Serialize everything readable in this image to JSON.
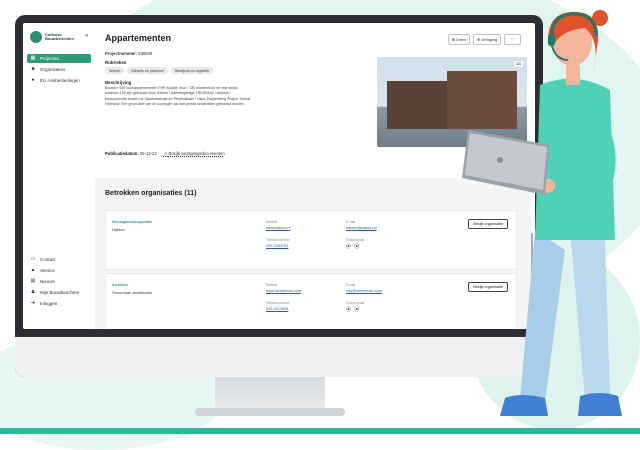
{
  "sidebar": {
    "logo_text_line1": "Collosse",
    "logo_text_line2": "Bouwberichten",
    "collapse_label": "«",
    "items": [
      {
        "label": "Projecten",
        "icon": "grid-icon",
        "active": true
      },
      {
        "label": "Organisaties",
        "icon": "folder-icon",
        "active": false
      },
      {
        "label": "EU Aanbestedingen",
        "icon": "globe-icon",
        "active": false
      }
    ],
    "bottom_items": [
      {
        "label": "Contact",
        "icon": "chat-icon"
      },
      {
        "label": "Service",
        "icon": "headset-icon"
      },
      {
        "label": "Nieuws",
        "icon": "news-icon"
      },
      {
        "label": "Mijn Bouwberichten",
        "icon": "user-icon"
      },
      {
        "label": "Inloggen",
        "icon": "login-icon"
      }
    ]
  },
  "project": {
    "title": "Appartementen",
    "project_number_label": "Projectnummer:",
    "project_number": "536839",
    "buttons": {
      "delen": "Delen",
      "verlaging": "Verlaging"
    },
    "rubrieken_label": "Rubrieken",
    "chips": [
      "Wonen",
      "Winkels en parkeren",
      "Bedrijven en logistiek"
    ],
    "beschrijving_label": "Beschrijving",
    "description": "Bouwen 445 huurappartementen FHR sociale huur / 130 middenhuur en vrije sector waarvan 125 zijn gebouwd door Habion / parkeergarage TRIGEMA2 / winkels / kantoorruimte tussen de Stadhuisstraat en Pesthuislaan / Hans Zwijnenberg Project 'Vooraf Helmond' Een groot deel van de woningen zal met prefab onderdelen gebouwd worden.",
    "publication_label": "Publicatiedatum:",
    "publication_date": "05-12-22",
    "bekijk_documents": "Bekijk voortgangsdocumenten",
    "photo_counter": "1/1"
  },
  "organisations": {
    "heading": "Betrokken organisaties (11)",
    "labels": {
      "website": "Website",
      "telefoon": "Telefoonnummer",
      "email": "E-mail",
      "social": "Social media"
    },
    "view_button": "Bekijk organisatie",
    "items": [
      {
        "type": "Woningbouwcorporatie",
        "name": "Habion",
        "website": "www.habion.nl",
        "phone": "030-2204704",
        "email": "habion@habion.nl",
        "social": "⦿ ⦿"
      },
      {
        "type": "Architect",
        "name": "Snoonman architecten",
        "website": "www.snoonman.com",
        "phone": "030-2014608",
        "email": "info@snoonman.com",
        "social": "⦿ ⦿"
      }
    ]
  },
  "colors": {
    "accent": "#2f9b76",
    "floor": "#2fb99a",
    "hair": "#e0532a",
    "shirt": "#4fd1b8"
  }
}
